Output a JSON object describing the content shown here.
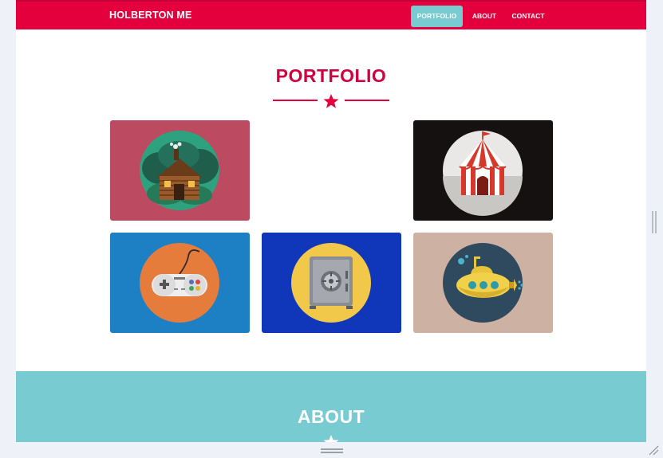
{
  "navbar": {
    "brand": "HOLBERTON ME",
    "links": [
      {
        "label": "PORTFOLIO",
        "active": true
      },
      {
        "label": "ABOUT",
        "active": false
      },
      {
        "label": "CONTACT",
        "active": false
      }
    ],
    "background": "#e3003d",
    "active_background": "#77cbd1"
  },
  "portfolio": {
    "title": "PORTFOLIO",
    "accent_color": "#d1003e",
    "divider_icon": "star-icon",
    "items": [
      {
        "icon": "cabin-icon",
        "background": "#bc4b61"
      },
      {
        "icon": "empty",
        "background": "#ffffff"
      },
      {
        "icon": "circus-tent-icon",
        "background": "#141110"
      },
      {
        "icon": "game-controller-icon",
        "background": "#1e80c4"
      },
      {
        "icon": "safe-icon",
        "background": "#1036b9"
      },
      {
        "icon": "submarine-icon",
        "background": "#cdb2a4"
      }
    ]
  },
  "about": {
    "title": "ABOUT",
    "background": "#77cbd1",
    "divider_icon": "star-icon"
  }
}
